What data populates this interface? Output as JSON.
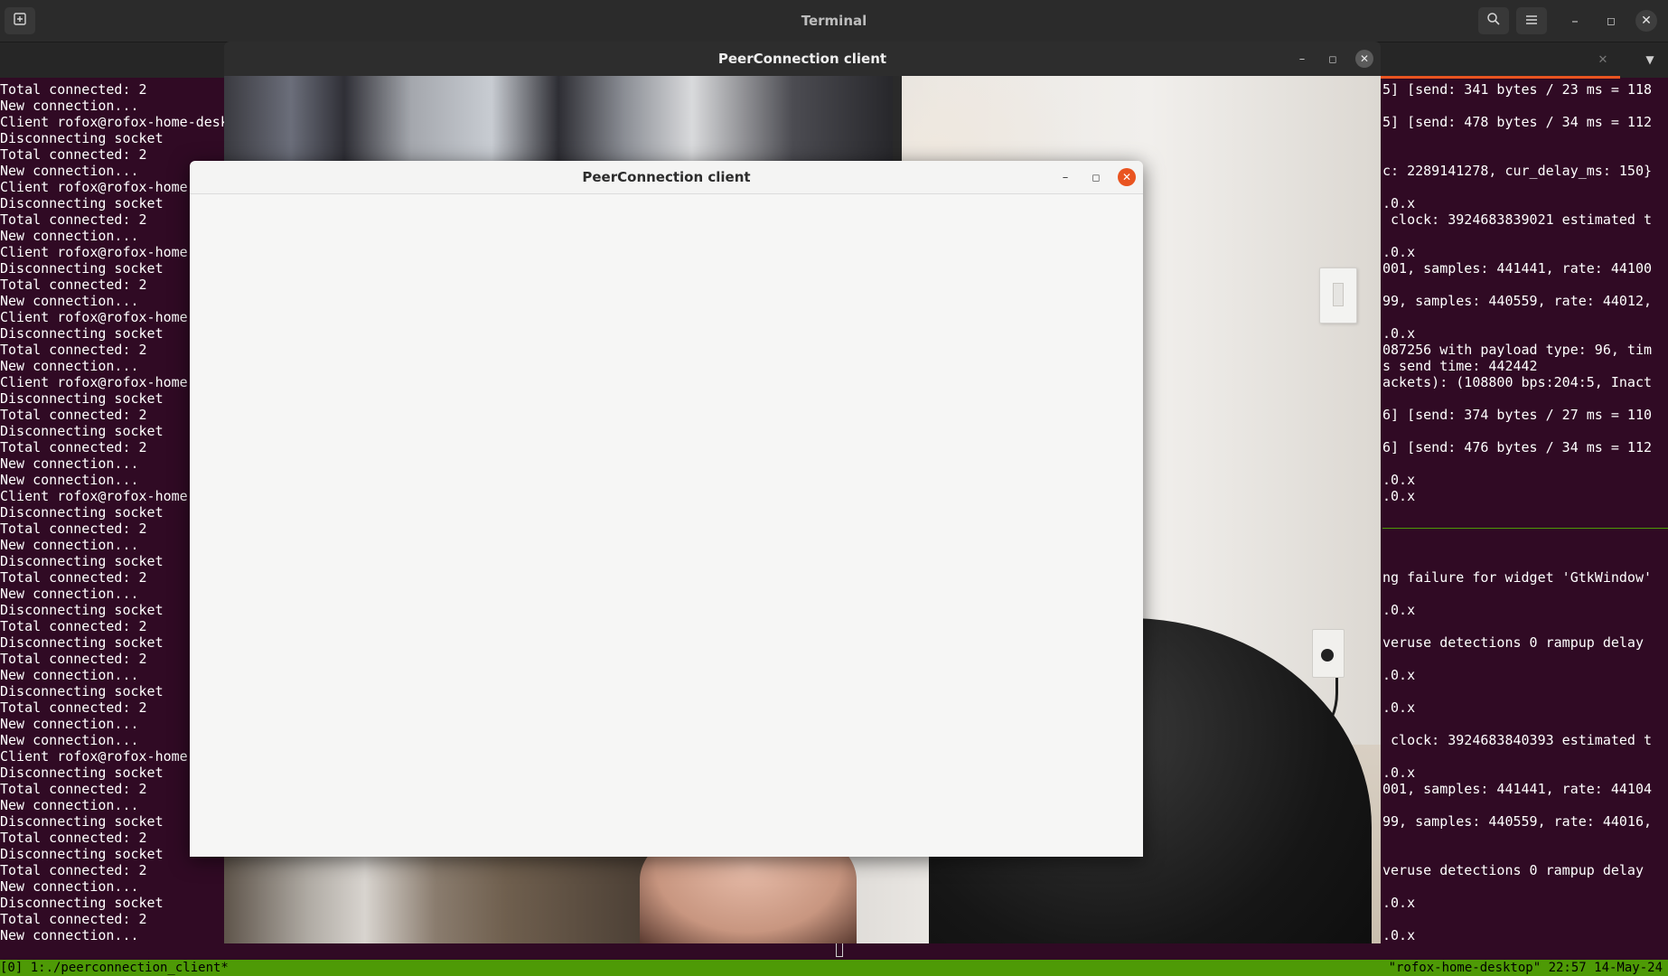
{
  "terminal": {
    "title": "Terminal",
    "new_tab_icon": "new-tab-icon",
    "search_icon": "search-icon",
    "menu_icon": "hamburger-menu-icon",
    "minimize_glyph": "–",
    "maximize_glyph": "◻",
    "close_glyph": "✕",
    "tab_close_glyph": "✕",
    "tab_dropdown_glyph": "▼"
  },
  "left_pane_lines": [
    "Total connected: 2",
    "New connection...",
    "Client rofox@rofox-home-desk",
    "Disconnecting socket",
    "Total connected: 2",
    "New connection...",
    "Client rofox@rofox-home-",
    "Disconnecting socket",
    "Total connected: 2",
    "New connection...",
    "Client rofox@rofox-home-",
    "Disconnecting socket",
    "Total connected: 2",
    "New connection...",
    "Client rofox@rofox-home-",
    "Disconnecting socket",
    "Total connected: 2",
    "New connection...",
    "Client rofox@rofox-home-",
    "Disconnecting socket",
    "Total connected: 2",
    "Disconnecting socket",
    "Total connected: 2",
    "New connection...",
    "New connection...",
    "Client rofox@rofox-home-",
    "Disconnecting socket",
    "Total connected: 2",
    "New connection...",
    "Disconnecting socket",
    "Total connected: 2",
    "New connection...",
    "Disconnecting socket",
    "Total connected: 2",
    "Disconnecting socket",
    "Total connected: 2",
    "New connection...",
    "Disconnecting socket",
    "Total connected: 2",
    "New connection...",
    "New connection...",
    "Client rofox@rofox-home-",
    "Disconnecting socket",
    "Total connected: 2",
    "New connection...",
    "Disconnecting socket",
    "Total connected: 2",
    "Disconnecting socket",
    "Total connected: 2",
    "New connection...",
    "Disconnecting socket",
    "Total connected: 2",
    "New connection..."
  ],
  "right_pane_lines": [
    "5] [send: 341 bytes / 23 ms = 118",
    "",
    "5] [send: 478 bytes / 34 ms = 112",
    "",
    "",
    "c: 2289141278, cur_delay_ms: 150}",
    "",
    ".0.x",
    " clock: 3924683839021 estimated t",
    "",
    ".0.x",
    "001, samples: 441441, rate: 44100",
    "",
    "99, samples: 440559, rate: 44012,",
    "",
    ".0.x",
    "087256 with payload type: 96, tim",
    "s send time: 442442",
    "ackets): (108800 bps:204:5, Inact",
    "",
    "6] [send: 374 bytes / 27 ms = 110",
    "",
    "6] [send: 476 bytes / 34 ms = 112",
    "",
    ".0.x",
    ".0.x",
    "",
    "",
    "",
    "ng failure for widget 'GtkWindow'",
    "",
    ".0.x",
    "",
    "veruse detections 0 rampup delay",
    "",
    ".0.x",
    "",
    ".0.x",
    "",
    " clock: 3924683840393 estimated t",
    "",
    ".0.x",
    "001, samples: 441441, rate: 44104",
    "",
    "99, samples: 440559, rate: 44016,",
    "",
    "",
    "veruse detections 0 rampup delay",
    "",
    ".0.x",
    "",
    ".0.x"
  ],
  "status_bar": {
    "left": "[0] 1:./peerconnection_client*",
    "right": "\"rofox-home-desktop\" 22:57 14-May-24"
  },
  "back_window": {
    "title": "PeerConnection client",
    "minimize_glyph": "–",
    "maximize_glyph": "◻",
    "close_glyph": "✕"
  },
  "front_window": {
    "title": "PeerConnection client",
    "minimize_glyph": "–",
    "maximize_glyph": "◻",
    "close_glyph": "✕"
  },
  "colors": {
    "terminal_bg": "#300a24",
    "status_bar_bg": "#4e9a06",
    "accent": "#e95420"
  }
}
